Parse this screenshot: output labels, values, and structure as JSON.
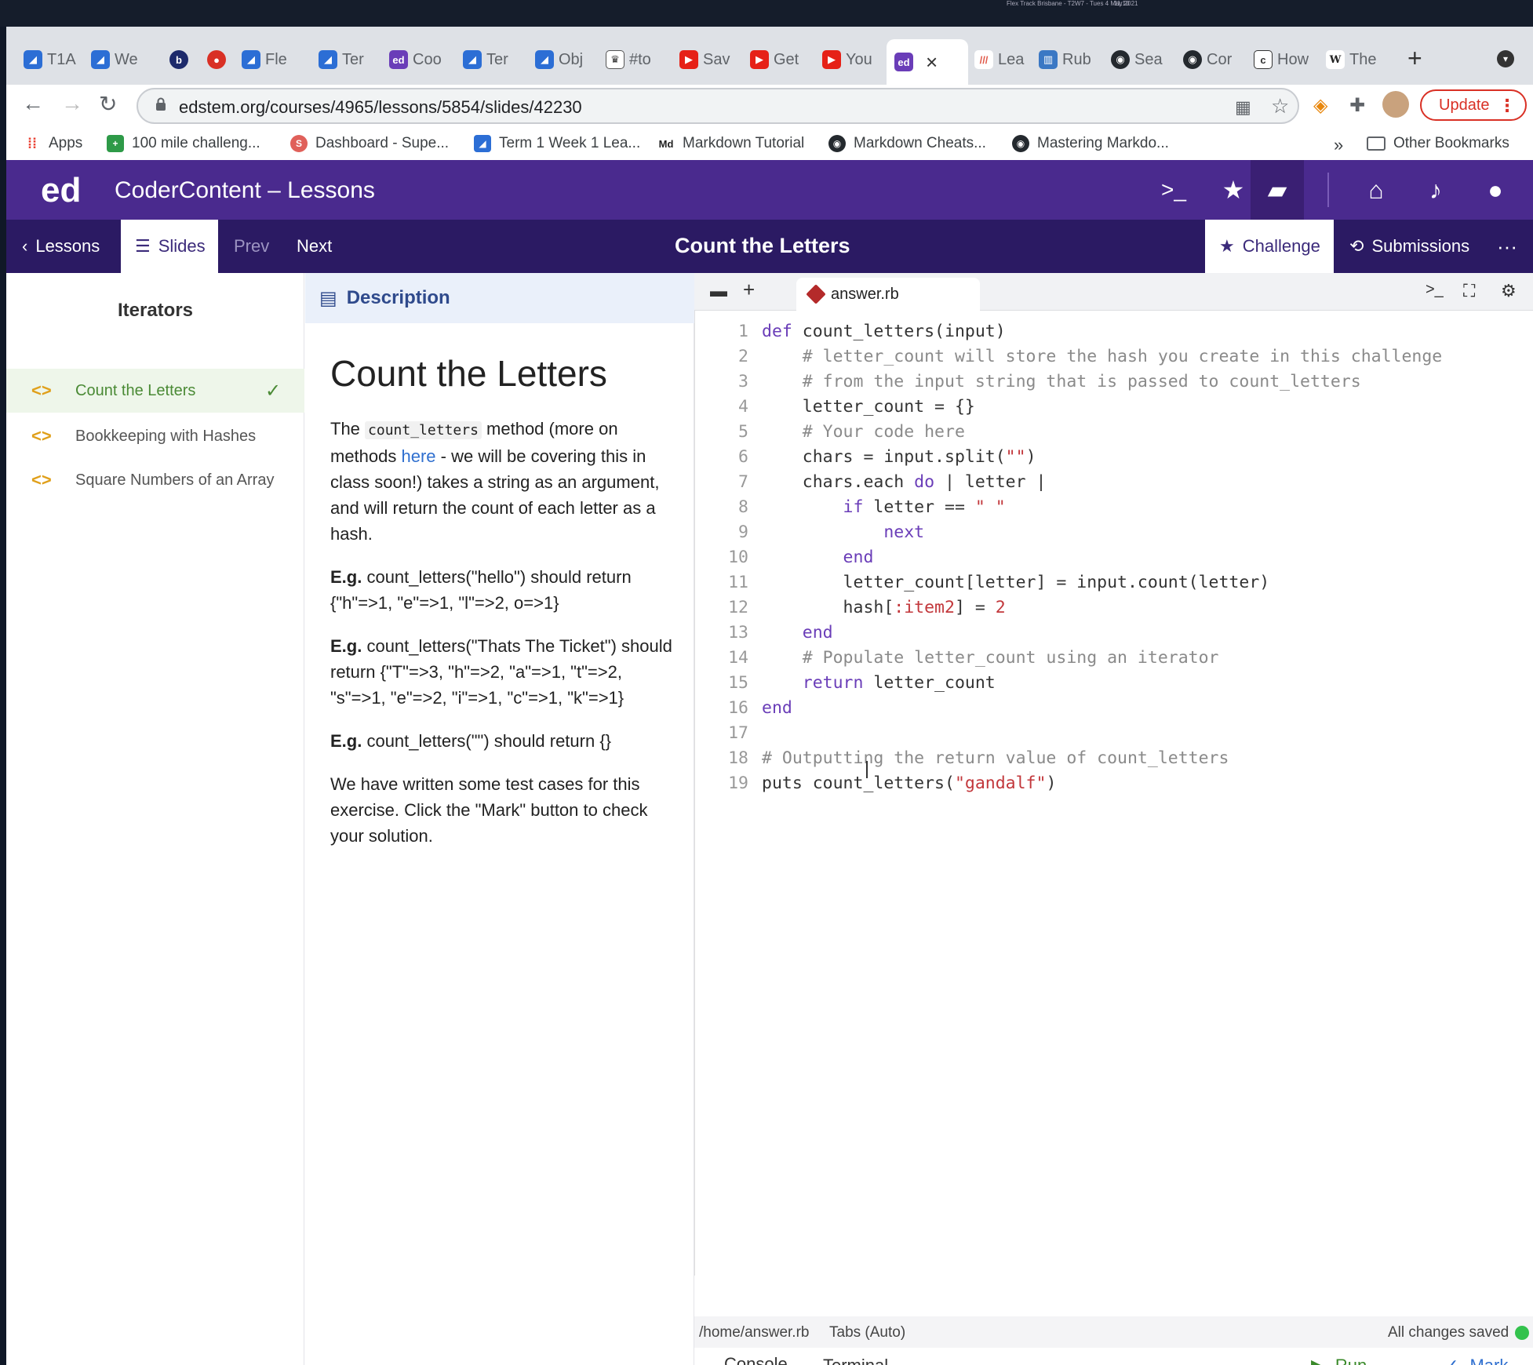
{
  "system": {
    "menubar_text": "Flex Track Brisbane - T2W7 - Tues 4 May 2021",
    "clock": "11:10"
  },
  "browser": {
    "tabs": [
      {
        "label": "T1A"
      },
      {
        "label": "We"
      },
      {
        "label": "b"
      },
      {
        "label": ""
      },
      {
        "label": "Fle"
      },
      {
        "label": "Ter"
      },
      {
        "label": "Coo"
      },
      {
        "label": "Ter"
      },
      {
        "label": "Obj"
      },
      {
        "label": "#to"
      },
      {
        "label": "Sav"
      },
      {
        "label": "Get"
      },
      {
        "label": "You"
      },
      {
        "label": ""
      },
      {
        "label": "Lea"
      },
      {
        "label": "Rub"
      },
      {
        "label": "Sea"
      },
      {
        "label": "Cor"
      },
      {
        "label": "How"
      },
      {
        "label": "The"
      }
    ],
    "url": "edstem.org/courses/4965/lessons/5854/slides/42230",
    "update_label": "Update",
    "bookmarks": [
      {
        "label": "Apps"
      },
      {
        "label": "100 mile challeng..."
      },
      {
        "label": "Dashboard - Supe..."
      },
      {
        "label": "Term 1 Week 1 Lea..."
      },
      {
        "label": "Markdown Tutorial"
      },
      {
        "label": "Markdown Cheats..."
      },
      {
        "label": "Mastering Markdo..."
      }
    ],
    "bookmarks_overflow": "»",
    "other_bookmarks": "Other Bookmarks"
  },
  "app": {
    "logo": "ed",
    "title": "CoderContent – Lessons",
    "nav": {
      "lessons": "Lessons",
      "slides": "Slides",
      "prev": "Prev",
      "next": "Next",
      "page_title": "Count the Letters",
      "challenge": "Challenge",
      "submissions": "Submissions"
    }
  },
  "sidebar": {
    "heading": "Iterators",
    "items": [
      {
        "label": "Count the Letters"
      },
      {
        "label": "Bookkeeping with Hashes"
      },
      {
        "label": "Square Numbers of an Array"
      }
    ]
  },
  "description": {
    "tab": "Description",
    "title": "Count the Letters",
    "p1_a": "The ",
    "p1_code": "count_letters",
    "p1_b": " method (more on methods ",
    "p1_link": "here",
    "p1_c": " - we will be covering this in class soon!) takes a string as an argument, and will return the count of each letter as a hash.",
    "eg_label": "E.g.",
    "eg1": " count_letters(\"hello\") should return {\"h\"=>1, \"e\"=>1, \"l\"=>2, o=>1}",
    "eg2": " count_letters(\"Thats The Ticket\") should return {\"T\"=>3, \"h\"=>2, \"a\"=>1, \"t\"=>2, \"s\"=>1, \"e\"=>2, \"i\"=>1, \"c\"=>1, \"k\"=>1}",
    "eg3": " count_letters(\"\") should return {}",
    "closing": "We have written some test cases for this exercise. Click the \"Mark\" button to check your solution."
  },
  "editor": {
    "filename": "answer.rb",
    "lines": [
      {
        "n": "1"
      },
      {
        "n": "2"
      },
      {
        "n": "3"
      },
      {
        "n": "4"
      },
      {
        "n": "5"
      },
      {
        "n": "6"
      },
      {
        "n": "7"
      },
      {
        "n": "8"
      },
      {
        "n": "9"
      },
      {
        "n": "10"
      },
      {
        "n": "11"
      },
      {
        "n": "12"
      },
      {
        "n": "13"
      },
      {
        "n": "14"
      },
      {
        "n": "15"
      },
      {
        "n": "16"
      },
      {
        "n": "17"
      },
      {
        "n": "18"
      },
      {
        "n": "19"
      }
    ],
    "code": {
      "l1_kw": "def",
      "l1_rest": " count_letters(input)",
      "l2": "    # letter_count will store the hash you create in this challenge",
      "l3": "    # from the input string that is passed to count_letters",
      "l4": "    letter_count = {}",
      "l5": "    # Your code here",
      "l6_a": "    chars = input.split(",
      "l6_s": "\"\"",
      "l6_b": ")",
      "l7_a": "    chars.each ",
      "l7_kw": "do",
      "l7_b": " | letter |",
      "l8_kw": "        if",
      "l8_a": " letter == ",
      "l8_s": "\" \"",
      "l9": "            next",
      "l10": "        end",
      "l11": "        letter_count[letter] = input.count(letter)",
      "l12_a": "        hash[",
      "l12_sy": ":item2",
      "l12_b": "] = ",
      "l12_n": "2",
      "l13": "    end",
      "l14": "    # Populate letter_count using an iterator",
      "l15_kw": "    return",
      "l15_rest": " letter_count",
      "l16": "end",
      "l17": "",
      "l18": "# Outputting the return value of count_letters",
      "l19_a": "puts count_letters(",
      "l19_s": "\"gandalf\"",
      "l19_b": ")"
    },
    "status_path": "/home/answer.rb",
    "status_tabs": "Tabs (Auto)",
    "status_saved": "All changes saved",
    "bottom": {
      "console": "Console",
      "terminal": "Terminal",
      "run": "Run",
      "mark": "Mark"
    }
  }
}
